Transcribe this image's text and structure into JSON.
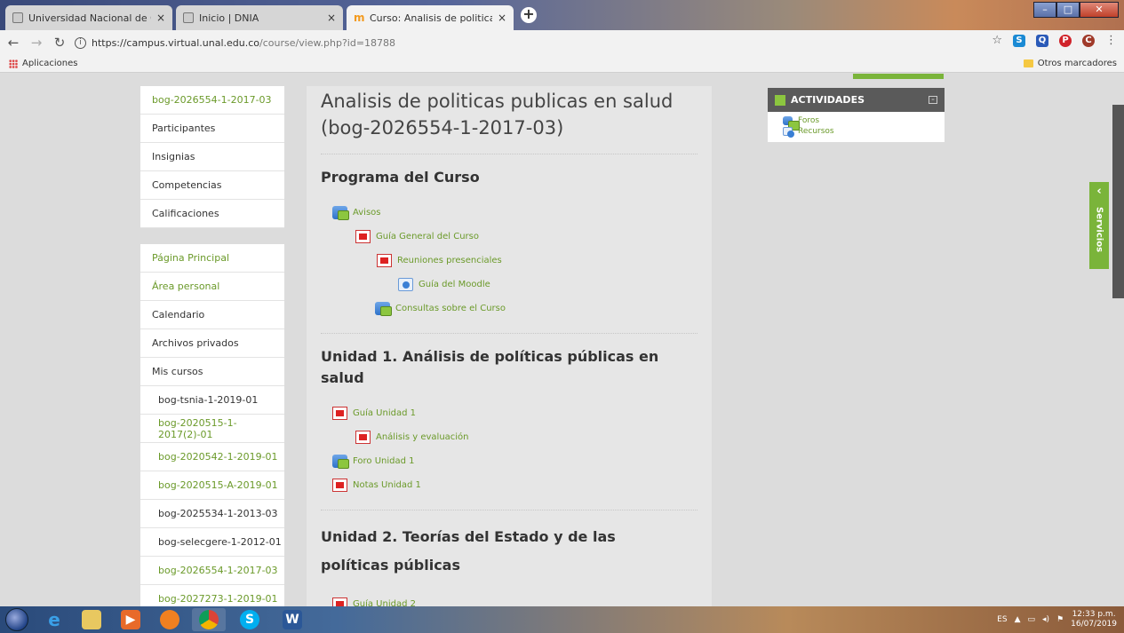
{
  "browser": {
    "tabs": [
      {
        "title": "Universidad Nacional de Colomb",
        "active": false
      },
      {
        "title": "Inicio | DNIA",
        "active": false
      },
      {
        "title": "Curso: Analisis de politicas public",
        "active": true
      }
    ],
    "close_glyph": "×",
    "new_tab_glyph": "+",
    "url_host": "https://campus.virtual.unal.edu.co",
    "url_path": "/course/view.php?id=18788",
    "apps_label": "Aplicaciones",
    "other_bookmarks_label": "Otros marcadores"
  },
  "sidebar": {
    "course_items": [
      {
        "label": "bog-2026554-1-2017-03",
        "link": true
      },
      {
        "label": "Participantes",
        "link": false
      },
      {
        "label": "Insignias",
        "link": false
      },
      {
        "label": "Competencias",
        "link": false
      },
      {
        "label": "Calificaciones",
        "link": false
      }
    ],
    "site_items": [
      {
        "label": "Página Principal",
        "link": true
      },
      {
        "label": "Área personal",
        "link": true
      },
      {
        "label": "Calendario",
        "link": false
      },
      {
        "label": "Archivos privados",
        "link": false
      },
      {
        "label": "Mis cursos",
        "link": false
      }
    ],
    "my_courses": [
      {
        "label": "bog-tsnia-1-2019-01",
        "link": false
      },
      {
        "label": "bog-2020515-1-2017(2)-01",
        "link": true
      },
      {
        "label": "bog-2020542-1-2019-01",
        "link": true
      },
      {
        "label": "bog-2020515-A-2019-01",
        "link": true
      },
      {
        "label": "bog-2025534-1-2013-03",
        "link": false
      },
      {
        "label": "bog-selecgere-1-2012-01",
        "link": false
      },
      {
        "label": "bog-2026554-1-2017-03",
        "link": true
      },
      {
        "label": "bog-2027273-1-2019-01",
        "link": true
      }
    ]
  },
  "main": {
    "course_title": "Analisis de politicas publicas en salud (bog-2026554-1-2017-03)",
    "sections": [
      {
        "title": "Programa del Curso",
        "activities": [
          {
            "label": "Avisos",
            "icon": "forum-icon",
            "indent": 0
          },
          {
            "label": "Guía General del Curso",
            "icon": "pdf-icon",
            "indent": 1
          },
          {
            "label": "Reuniones presenciales",
            "icon": "pdf-icon",
            "indent": 2
          },
          {
            "label": "Guía del Moodle",
            "icon": "url-icon",
            "indent": 3
          },
          {
            "label": "Consultas sobre el Curso",
            "icon": "forum-icon",
            "indent": 2
          }
        ]
      },
      {
        "title": "Unidad 1. Análisis de políticas públicas en salud",
        "activities": [
          {
            "label": "Guía Unidad 1",
            "icon": "pdf-icon",
            "indent": 0
          },
          {
            "label": "Análisis y evaluación",
            "icon": "pdf-icon",
            "indent": 1
          },
          {
            "label": "Foro Unidad 1",
            "icon": "forum-icon",
            "indent": 0
          },
          {
            "label": "Notas Unidad 1",
            "icon": "pdf-icon",
            "indent": 0
          }
        ]
      },
      {
        "title": "Unidad 2. Teorías del Estado y de las políticas públicas",
        "activities": [
          {
            "label": "Guía Unidad 2",
            "icon": "pdf-icon",
            "indent": 0
          }
        ]
      }
    ]
  },
  "activities_block": {
    "title": "ACTIVIDADES",
    "items": [
      {
        "label": "Foros",
        "icon": "forum-icon"
      },
      {
        "label": "Recursos",
        "icon": "resource-icon"
      }
    ]
  },
  "services_tab": {
    "label": "Servicios",
    "chevron": "‹"
  },
  "taskbar": {
    "lang": "ES",
    "time": "12:33 p.m.",
    "date": "16/07/2019"
  },
  "colors": {
    "link_green": "#6b9a2a",
    "accent_green": "#7ab43a",
    "header_gray": "#5a5a5a"
  }
}
